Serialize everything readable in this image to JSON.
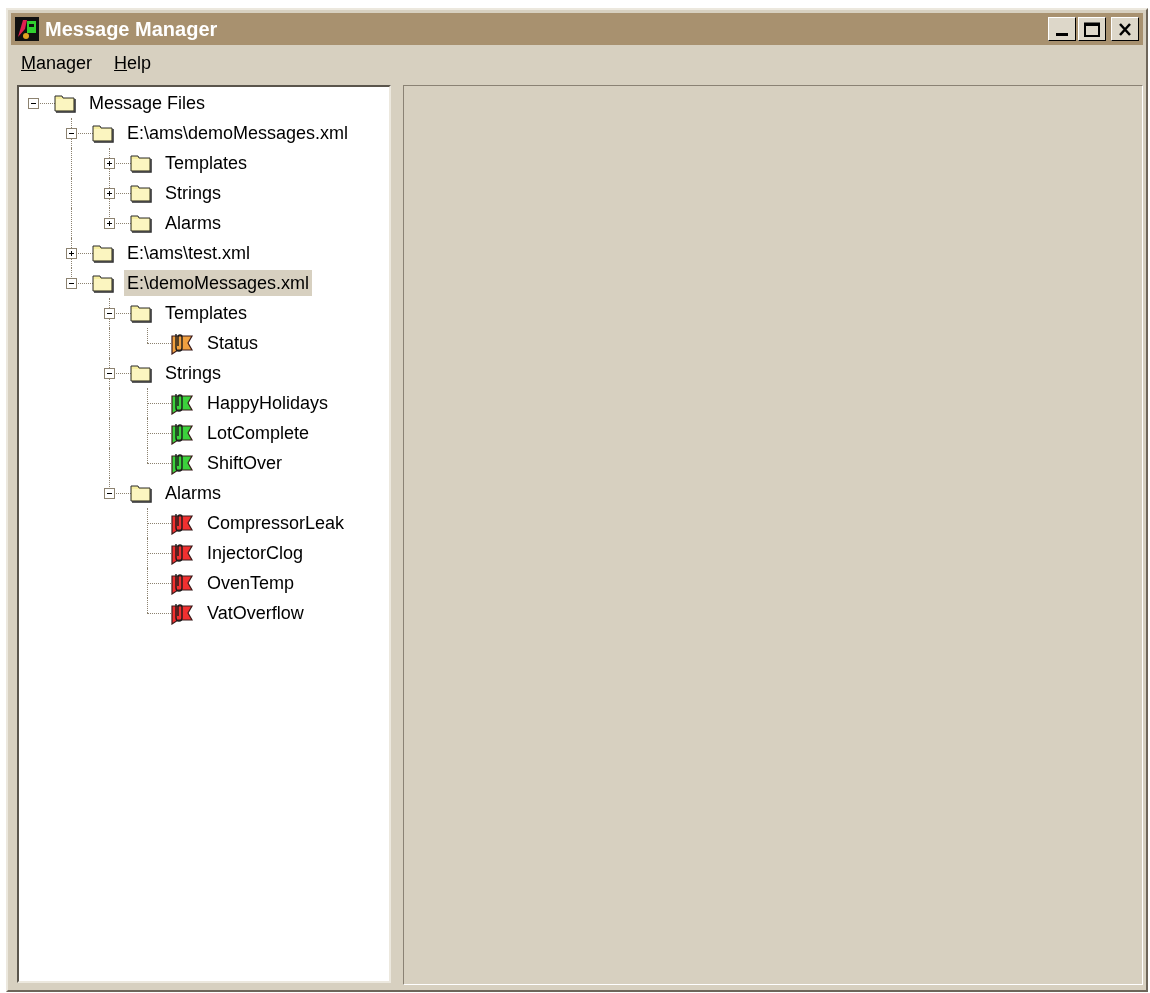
{
  "window": {
    "title": "Message Manager"
  },
  "menu": [
    {
      "label": "Manager"
    },
    {
      "label": "Help"
    }
  ],
  "tree": [
    {
      "label": "Message Files",
      "kind": "folder",
      "expanded": true,
      "selected": false,
      "children": [
        {
          "label": "E:\\ams\\demoMessages.xml",
          "kind": "folder",
          "expanded": true,
          "selected": false,
          "children": [
            {
              "label": "Templates",
              "kind": "folder",
              "expanded": false,
              "selected": false
            },
            {
              "label": "Strings",
              "kind": "folder",
              "expanded": false,
              "selected": false
            },
            {
              "label": "Alarms",
              "kind": "folder",
              "expanded": false,
              "selected": false
            }
          ]
        },
        {
          "label": "E:\\ams\\test.xml",
          "kind": "folder",
          "expanded": false,
          "selected": false
        },
        {
          "label": "E:\\demoMessages.xml",
          "kind": "folder",
          "expanded": true,
          "selected": true,
          "children": [
            {
              "label": "Templates",
              "kind": "folder",
              "expanded": true,
              "selected": false,
              "children": [
                {
                  "label": "Status",
                  "kind": "message",
                  "color": "#f0a040",
                  "selected": false
                }
              ]
            },
            {
              "label": "Strings",
              "kind": "folder",
              "expanded": true,
              "selected": false,
              "children": [
                {
                  "label": "HappyHolidays",
                  "kind": "message",
                  "color": "#3cd23c",
                  "selected": false
                },
                {
                  "label": "LotComplete",
                  "kind": "message",
                  "color": "#3cd23c",
                  "selected": false
                },
                {
                  "label": "ShiftOver",
                  "kind": "message",
                  "color": "#3cd23c",
                  "selected": false
                }
              ]
            },
            {
              "label": "Alarms",
              "kind": "folder",
              "expanded": true,
              "selected": false,
              "children": [
                {
                  "label": "CompressorLeak",
                  "kind": "message",
                  "color": "#f03030",
                  "selected": false
                },
                {
                  "label": "InjectorClog",
                  "kind": "message",
                  "color": "#f03030",
                  "selected": false
                },
                {
                  "label": "OvenTemp",
                  "kind": "message",
                  "color": "#f03030",
                  "selected": false
                },
                {
                  "label": "VatOverflow",
                  "kind": "message",
                  "color": "#f03030",
                  "selected": false
                }
              ]
            }
          ]
        }
      ]
    }
  ]
}
